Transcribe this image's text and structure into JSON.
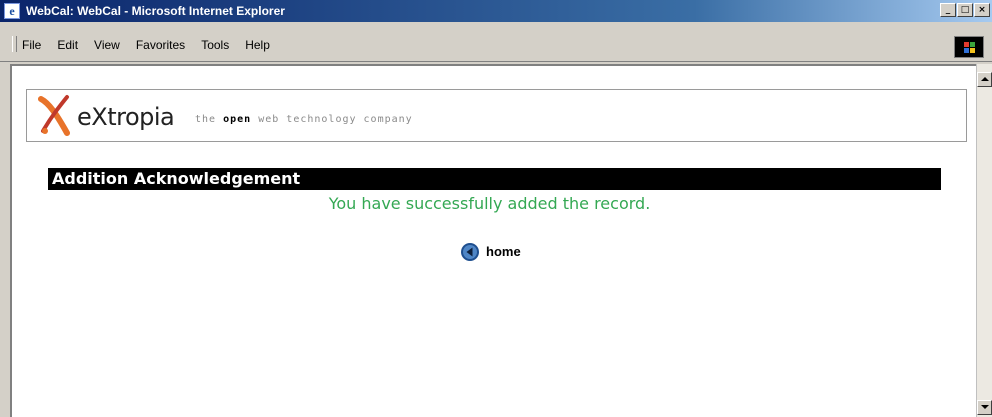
{
  "window": {
    "title": "WebCal: WebCal - Microsoft Internet Explorer",
    "title_icon": "ie-icon",
    "controls": [
      "minimize",
      "maximize",
      "close"
    ]
  },
  "menu": {
    "items": [
      "File",
      "Edit",
      "View",
      "Favorites",
      "Tools",
      "Help"
    ]
  },
  "logo": {
    "word": "eXtropia",
    "tagline_pre": "the",
    "tagline_bold": "open",
    "tagline_post": "web technology company",
    "mark_color": "#e8732a",
    "mark_secondary_color": "#c0392b"
  },
  "main": {
    "section_title": "Addition Acknowledgement",
    "message": "You have successfully added the record.",
    "home_label": "home",
    "home_icon": "back-arrow-icon"
  },
  "colors": {
    "message": "#34a853",
    "section_bar": "#000000",
    "titlebar": "#0a246a"
  }
}
